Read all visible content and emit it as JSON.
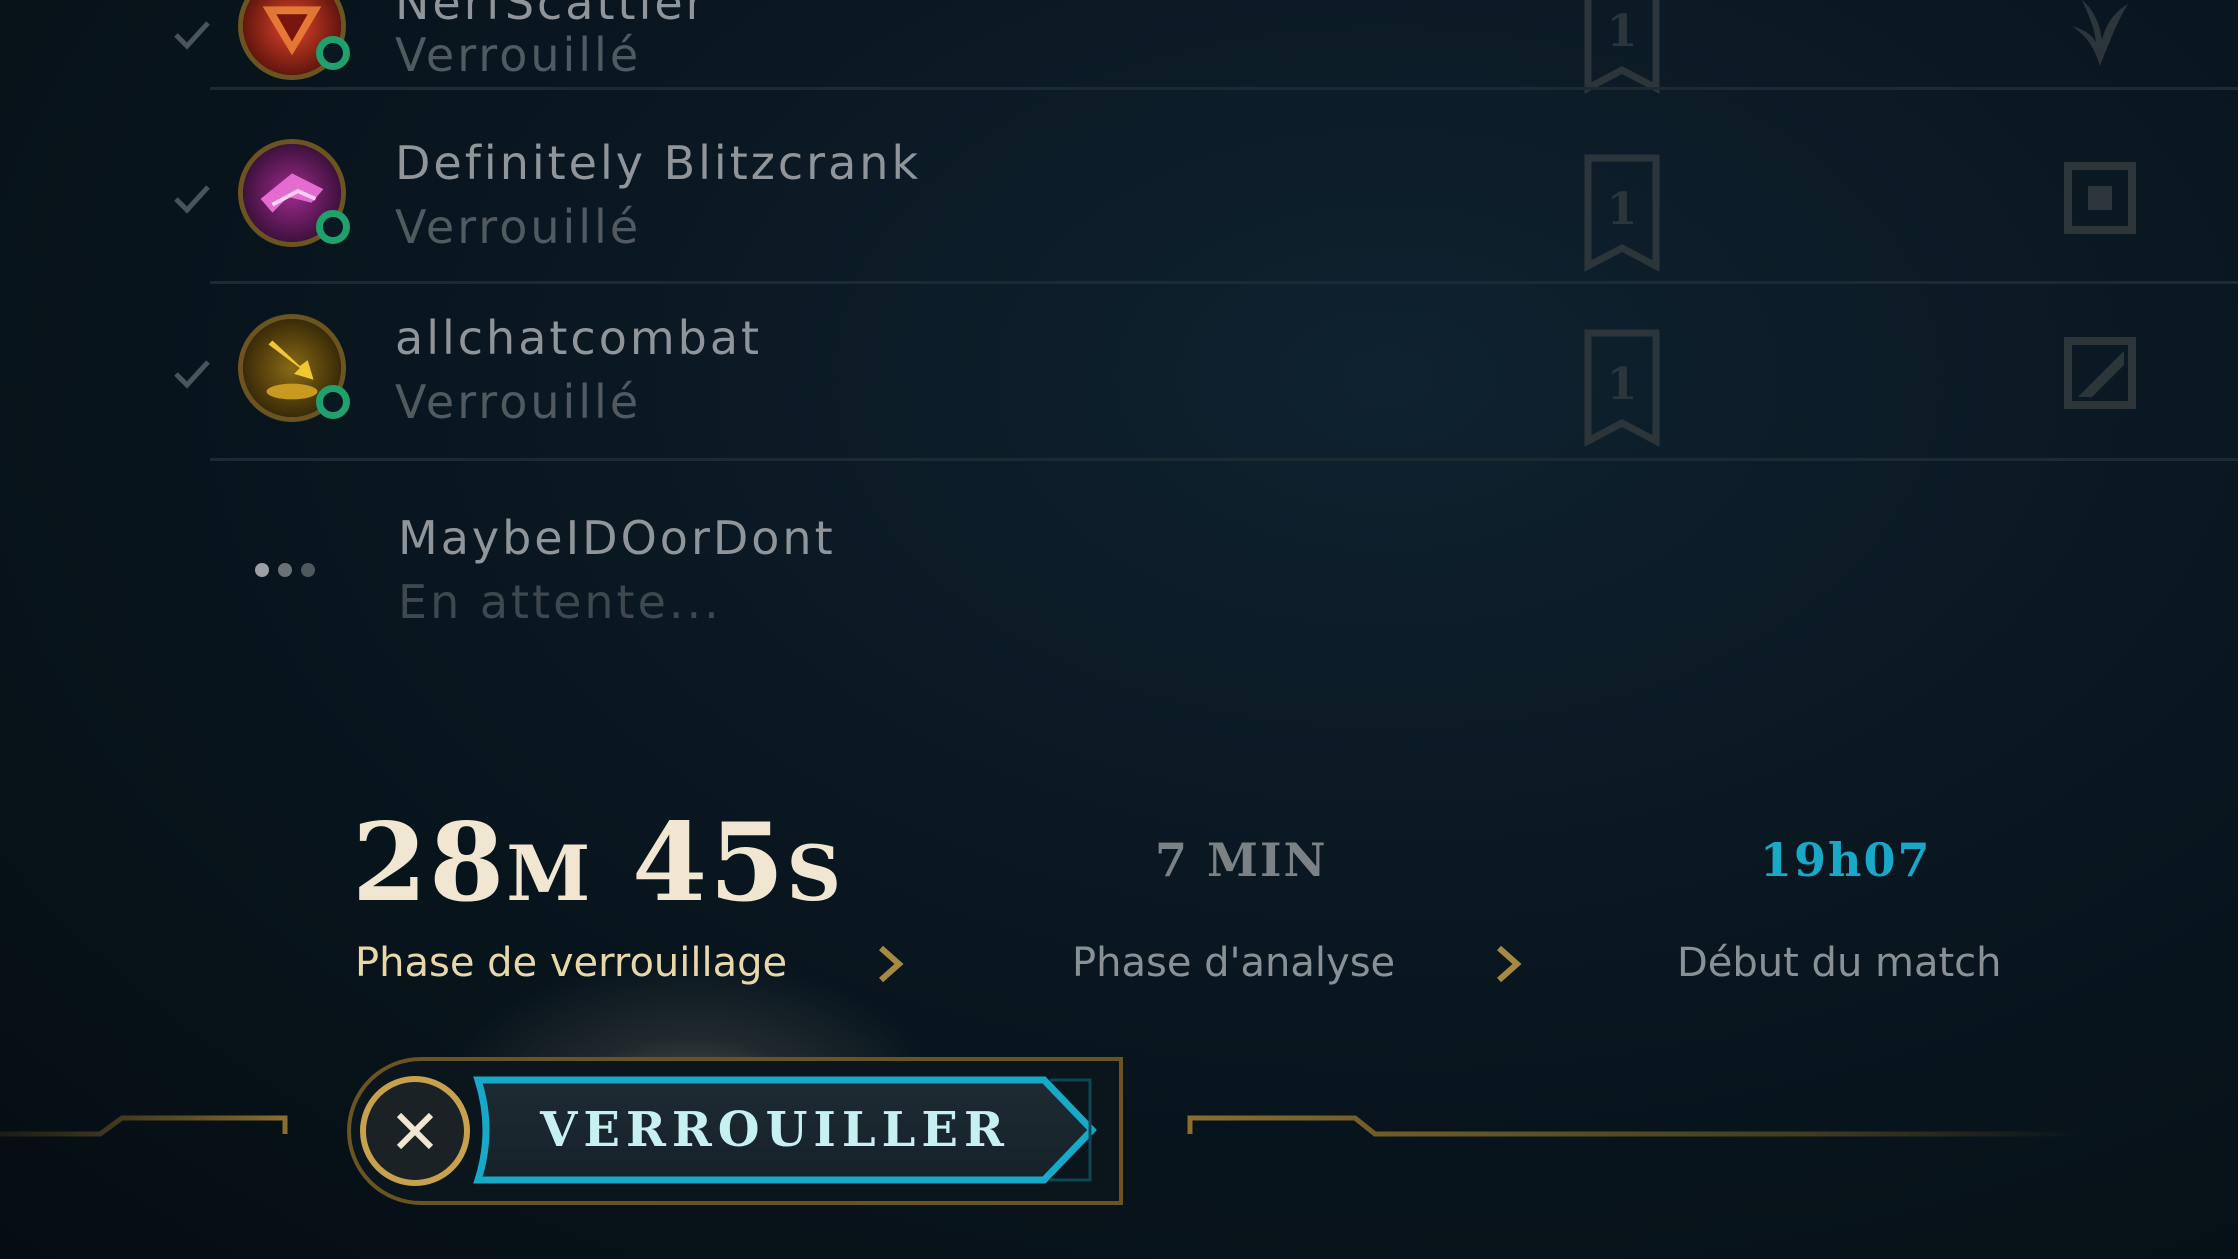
{
  "players": [
    {
      "name": "NerfScattler",
      "status": "Verrouillé",
      "ticket": "1"
    },
    {
      "name": "Definitely Blitzcrank",
      "status": "Verrouillé",
      "ticket": "1"
    },
    {
      "name": "allchatcombat",
      "status": "Verrouillé",
      "ticket": "1"
    },
    {
      "name": "MaybeIDOorDont",
      "status": "En attente..."
    }
  ],
  "timer": {
    "minutes": "28",
    "minutes_unit": "M",
    "seconds": "45",
    "seconds_unit": "S",
    "label": "Phase de verrouillage"
  },
  "analysis": {
    "duration": "7 MIN",
    "label": "Phase d'analyse"
  },
  "match": {
    "start_time": "19h07",
    "label": "Début du match"
  },
  "actions": {
    "lock_label": "VERROUILLER"
  },
  "colors": {
    "gold": "#c8a14f",
    "online_green": "#1fa06c",
    "accent_cyan": "#18a9c9",
    "timer_text": "#f0e6d2"
  }
}
